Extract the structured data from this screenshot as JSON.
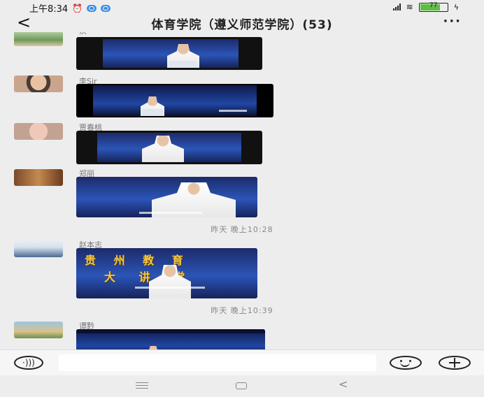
{
  "status_bar": {
    "time": "上午8:34",
    "battery": "77"
  },
  "header": {
    "back_glyph": "<",
    "title": "体育学院（遵义师范学院）(53)",
    "more_glyph": "···"
  },
  "messages": [
    {
      "sender": "沃"
    },
    {
      "sender": "李Sir"
    },
    {
      "sender": "贾春桃"
    },
    {
      "sender": "郑丽"
    },
    {
      "sender": "赵本志"
    },
    {
      "sender": "谭黔"
    }
  ],
  "timestamps": [
    "昨天 晚上10:28",
    "昨天 晚上10:39"
  ],
  "video_captions": {
    "bg_title": "贵 州 教 育",
    "bg_title2": "大 讲 堂"
  },
  "input_bar": {
    "placeholder": ""
  },
  "colors": {
    "background": "#ededed",
    "video_blue": "#2b55b8"
  }
}
